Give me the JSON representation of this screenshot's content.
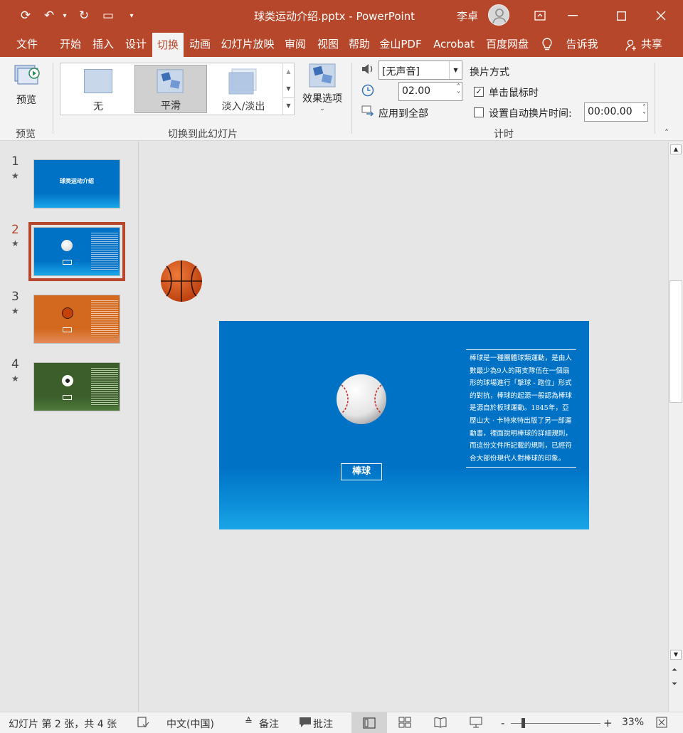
{
  "window": {
    "title": "球类运动介绍.pptx - PowerPoint",
    "user": "李卓"
  },
  "menu_tabs": [
    "文件",
    "开始",
    "插入",
    "设计",
    "切换",
    "动画",
    "幻灯片放映",
    "审阅",
    "视图",
    "帮助",
    "金山PDF",
    "Acrobat",
    "百度网盘",
    "告诉我",
    "共享"
  ],
  "ribbon": {
    "preview": {
      "button": "预览",
      "group": "预览"
    },
    "transitions": {
      "items": [
        "无",
        "平滑",
        "淡入/淡出"
      ],
      "selected": "平滑",
      "effect_options": "效果选项",
      "group": "切换到此幻灯片"
    },
    "timing": {
      "sound": "[无声音]",
      "duration": "02.00",
      "apply_all": "应用到全部",
      "advance_title": "换片方式",
      "on_click": "单击鼠标时",
      "on_click_checked": true,
      "after_label": "设置自动换片时间:",
      "after_checked": false,
      "after_value": "00:00.00",
      "group": "计时"
    }
  },
  "slides_pane": [
    {
      "num": "1",
      "title": "球类运动介绍",
      "theme": "blue"
    },
    {
      "num": "2",
      "caption": "棒球",
      "theme": "blue",
      "selected": true
    },
    {
      "num": "3",
      "caption": "篮球",
      "theme": "orange"
    },
    {
      "num": "4",
      "caption": "足球",
      "theme": "green"
    }
  ],
  "slide": {
    "caption": "棒球",
    "body": "棒球是一種團體球類運動，是由人數最少為9人的兩支隊伍在一個扇形的球場進行「擊球 - 跑位」形式的對抗，棒球的起源一般認為棒球是源自於板球運動。1845年，亞歷山大 · 卡特來特出版了另一部運動書，裡面說明棒球的詳細規則，而這份文件所記載的規則，已經符合大部份現代人對棒球的印象。"
  },
  "status": {
    "slide_info": "幻灯片 第 2 张，共 4 张",
    "language": "中文(中国)",
    "notes": "备注",
    "comments": "批注",
    "zoom": "33%"
  },
  "colors": {
    "accent": "#b7472a",
    "slide_blue": "#0072c6",
    "thumb_orange": "#d2691e",
    "thumb_green": "#3b5e2b"
  }
}
